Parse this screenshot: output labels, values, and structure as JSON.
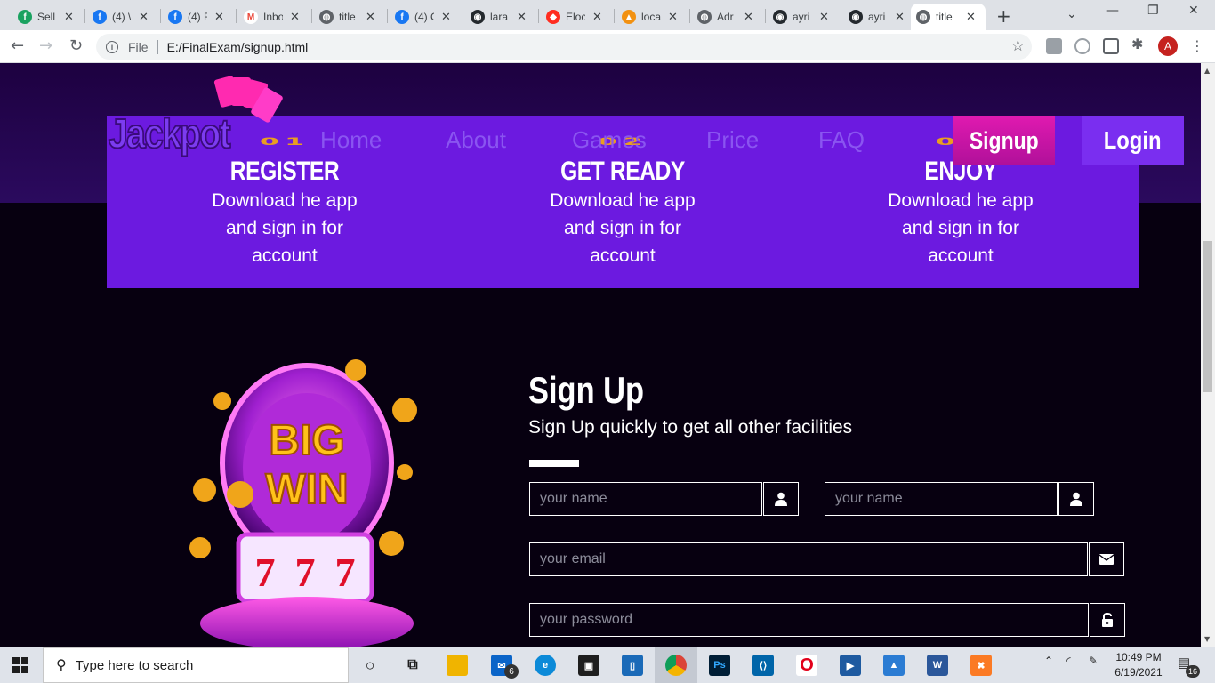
{
  "browser": {
    "tabs": [
      {
        "title": "Sell",
        "color": "#1aa260",
        "glyph": "f"
      },
      {
        "title": "(4) \\",
        "color": "#1877f2",
        "glyph": "f"
      },
      {
        "title": "(4) F",
        "color": "#1877f2",
        "glyph": "f"
      },
      {
        "title": "Inbo",
        "color": "#ea4335",
        "glyph": "M"
      },
      {
        "title": "title",
        "color": "#5f6368",
        "glyph": "◍"
      },
      {
        "title": "(4) C",
        "color": "#1877f2",
        "glyph": "f"
      },
      {
        "title": "lara",
        "color": "#24292e",
        "glyph": "◉"
      },
      {
        "title": "Eloc",
        "color": "#ff2d20",
        "glyph": "◆"
      },
      {
        "title": "loca",
        "color": "#f29111",
        "glyph": "▲"
      },
      {
        "title": "Adr",
        "color": "#5f6368",
        "glyph": "◍"
      },
      {
        "title": "ayri",
        "color": "#24292e",
        "glyph": "◉"
      },
      {
        "title": "ayri",
        "color": "#24292e",
        "glyph": "◉"
      },
      {
        "title": "title",
        "color": "#5f6368",
        "glyph": "◍"
      }
    ],
    "address": {
      "scheme_label": "File",
      "url": "E:/FinalExam/signup.html"
    },
    "profile_initial": "A"
  },
  "site": {
    "logo": "Jackpot",
    "nav": [
      "Home",
      "About",
      "Games",
      "Price",
      "FAQ"
    ],
    "signup_button": "Signup",
    "login_button": "Login"
  },
  "steps": [
    {
      "num": "01",
      "title": "REGISTER",
      "text": "Download he app and sign in for account"
    },
    {
      "num": "02",
      "title": "GET READY",
      "text": "Download he app and sign in for account"
    },
    {
      "num": "03",
      "title": "ENJOY",
      "text": "Download he app and sign in for account"
    }
  ],
  "signup": {
    "title": "Sign Up",
    "subtitle": "Sign Up quickly to get all other facilities",
    "first_name_placeholder": "your name",
    "last_name_placeholder": "your name",
    "email_placeholder": "your email",
    "password_placeholder": "your password"
  },
  "taskbar": {
    "search_placeholder": "Type here to search",
    "mail_badge": "6",
    "notification_badge": "16",
    "time": "10:49 PM",
    "date": "6/19/2021"
  },
  "colors": {
    "step_panel": "#6c1ae0",
    "signup_btn": "#e01ab0",
    "login_btn": "#7a2ef0",
    "page_bg": "#070010"
  }
}
